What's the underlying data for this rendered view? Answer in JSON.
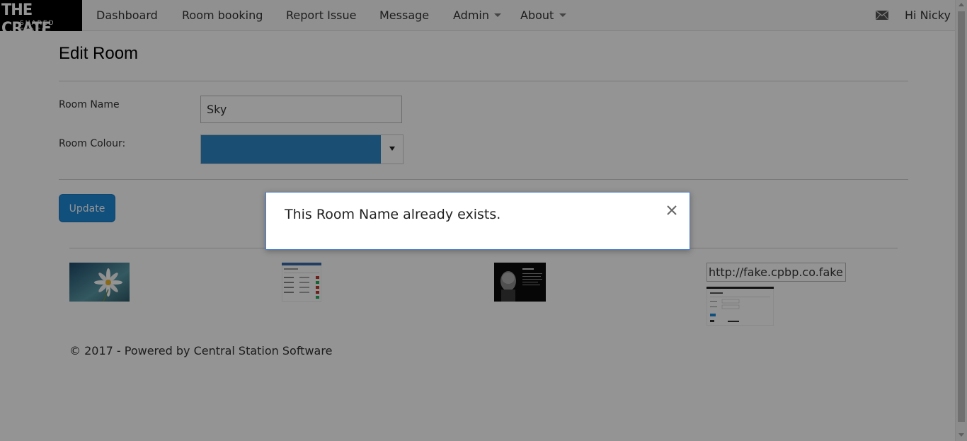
{
  "brand": {
    "line1": "THE CRATE",
    "line2": "SHARED SPACE"
  },
  "nav": {
    "items": [
      {
        "label": "Dashboard"
      },
      {
        "label": "Room booking"
      },
      {
        "label": "Report Issue"
      },
      {
        "label": "Message"
      },
      {
        "label": "Admin"
      },
      {
        "label": "About"
      }
    ],
    "greeting": "Hi Nicky"
  },
  "page": {
    "title": "Edit Room"
  },
  "form": {
    "room_name_label": "Room Name",
    "room_name_value": "Sky",
    "room_colour_label": "Room Colour:",
    "room_colour_value": "#2e87c4",
    "update_label": "Update"
  },
  "gallery": {
    "broken_image_alt": "http://fake.cpbp.co.fake"
  },
  "footer": {
    "text": "© 2017 - Powered by Central Station Software"
  },
  "modal": {
    "message": "This Room Name already exists."
  },
  "icons": {
    "mail": "envelope-icon",
    "close": "close-icon",
    "caret": "caret-down-icon"
  }
}
